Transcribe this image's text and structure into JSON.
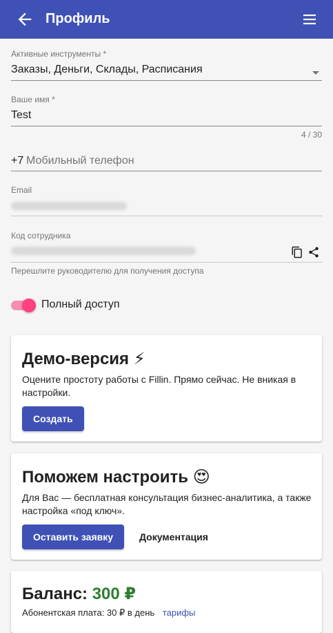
{
  "appbar": {
    "title": "Профиль"
  },
  "tools": {
    "label": "Активные инструменты *",
    "value": "Заказы, Деньги, Склады, Расписания"
  },
  "name": {
    "label": "Ваше имя *",
    "value": "Test",
    "counter": "4 / 30"
  },
  "phone": {
    "prefix": "+7",
    "placeholder": "Мобильный телефон"
  },
  "email": {
    "label": "Email"
  },
  "employee_code": {
    "label": "Код сотрудника",
    "hint": "Перешлите руководителю для получения доступа"
  },
  "access": {
    "label": "Полный доступ",
    "enabled": true
  },
  "demo_card": {
    "title": "Демо-версия ⚡",
    "text": "Оцените простоту работы с Fillin. Прямо сейчас. Не вникая в настройки.",
    "button": "Создать"
  },
  "help_card": {
    "title": "Поможем настроить 😍",
    "text": "Для Вас — бесплатная консультация бизнес-аналитика, а также настройка «под ключ».",
    "primary_button": "Оставить заявку",
    "secondary_button": "Документация"
  },
  "balance_card": {
    "title_prefix": "Баланс:",
    "amount": "300 ₽",
    "fee_text": "Абонентская плата: 30 ₽ в день",
    "tariffs_link": "тарифы"
  },
  "colors": {
    "primary": "#3f51b5",
    "accent": "#ff4081",
    "balance": "#2e7d32",
    "link": "#3f51b5"
  }
}
